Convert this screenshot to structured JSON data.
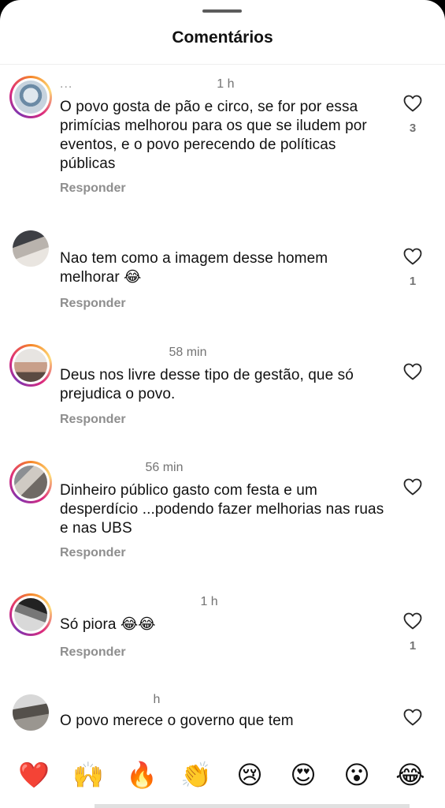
{
  "sheet": {
    "title": "Comentários"
  },
  "comments": [
    {
      "user": "...",
      "time": "1 h",
      "text": "O povo gosta de pão e circo, se for por essa primícias melhorou para os que se iludem por eventos, e o povo perecendo de políticas públicas",
      "reply": "Responder",
      "likes": "3"
    },
    {
      "user": "",
      "time": "",
      "text": "Nao tem como a imagem desse homem melhorar",
      "emoji": "😂",
      "reply": "Responder",
      "likes": "1"
    },
    {
      "user": "",
      "time": "58 min",
      "text": "Deus nos livre desse tipo de gestão, que só prejudica o povo.",
      "reply": "Responder",
      "likes": ""
    },
    {
      "user": "",
      "time": "56 min",
      "text": "Dinheiro público gasto com festa e um desperdício ...podendo fazer melhorias nas ruas e nas UBS",
      "reply": "Responder",
      "likes": ""
    },
    {
      "user": "",
      "time": "1 h",
      "text": "Só piora",
      "emoji": "😂😂",
      "reply": "Responder",
      "likes": "1"
    },
    {
      "user": "",
      "time": "h",
      "text": "O povo merece o governo que tem",
      "reply": "",
      "likes": ""
    }
  ],
  "reactions": [
    "❤️",
    "🙌",
    "🔥",
    "👏",
    "😢",
    "😍",
    "😮",
    "😂"
  ],
  "icons": {
    "like": "heart-outline-icon"
  },
  "colors": {
    "ring_start": "#f58529",
    "ring_mid": "#dd2a7b",
    "ring_end": "#8134af",
    "muted": "#737373"
  }
}
